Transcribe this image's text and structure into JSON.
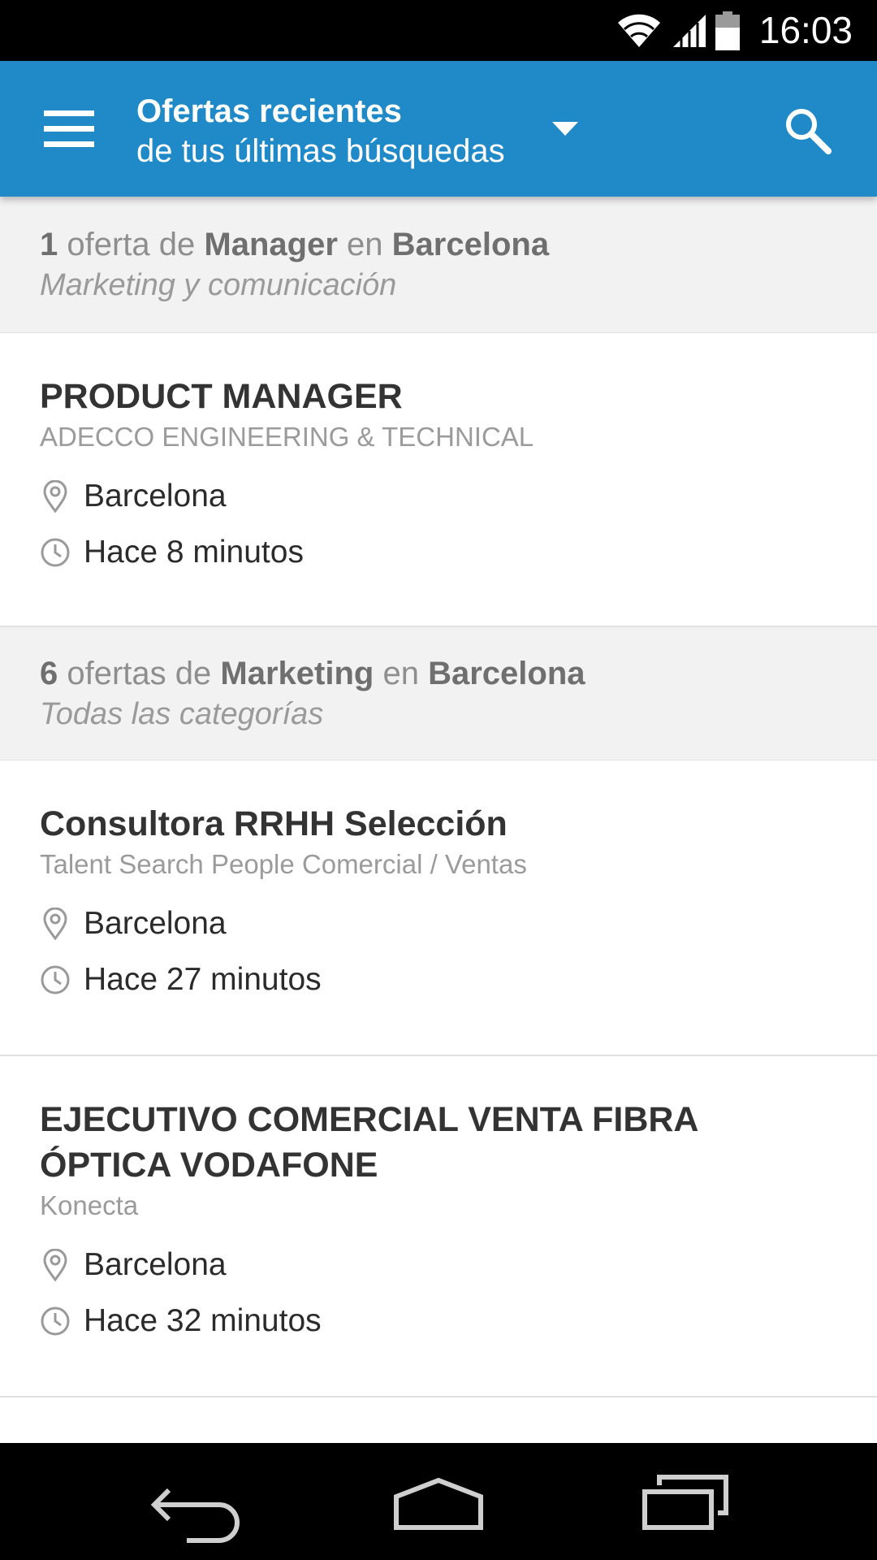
{
  "status_bar": {
    "time": "16:03"
  },
  "app_bar": {
    "title": "Ofertas recientes",
    "subtitle": "de tus últimas búsquedas"
  },
  "groups": [
    {
      "count": "1",
      "word_offer": "oferta de",
      "keyword": "Manager",
      "word_in": "en",
      "location": "Barcelona",
      "category": "Marketing y comunicación",
      "jobs": [
        {
          "title": "PRODUCT MANAGER",
          "company": "ADECCO ENGINEERING & TECHNICAL",
          "location": "Barcelona",
          "time": "Hace 8 minutos"
        }
      ]
    },
    {
      "count": "6",
      "word_offer": "ofertas de",
      "keyword": "Marketing",
      "word_in": "en",
      "location": "Barcelona",
      "category": "Todas las categorías",
      "jobs": [
        {
          "title": "Consultora RRHH Selección",
          "company": "Talent Search People  Comercial / Ventas",
          "location": "Barcelona",
          "time": "Hace 27 minutos"
        },
        {
          "title_line1": "EJECUTIVO COMERCIAL VENTA FIBRA",
          "title_line2": "ÓPTICA  VODAFONE",
          "company": "Konecta",
          "location": "Barcelona",
          "time": "Hace 32 minutos"
        }
      ]
    }
  ],
  "icons": {
    "menu": "menu-icon",
    "dropdown": "dropdown-arrow-icon",
    "search": "search-icon",
    "location": "location-pin-icon",
    "time": "clock-icon",
    "back": "back-icon",
    "home": "home-icon",
    "recents": "recents-icon"
  },
  "colors": {
    "app_bar": "#208ac9",
    "group_header_bg": "#f2f2f2",
    "title_text": "#333333",
    "muted_text": "#9b9b9b"
  }
}
